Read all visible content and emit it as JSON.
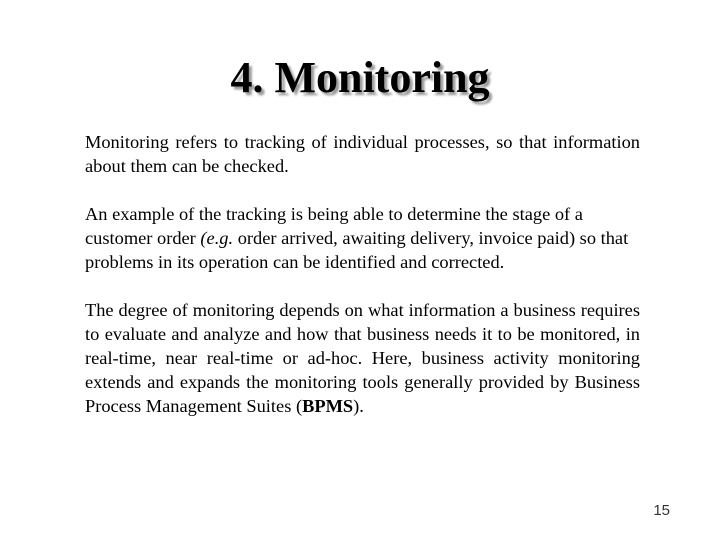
{
  "slide": {
    "title": "4.  Monitoring",
    "paragraphs": {
      "p1": "Monitoring refers to tracking of individual processes, so that information about them can be checked.",
      "p2_before": "An example of the tracking is being able to determine the stage of a customer order ",
      "p2_italic": "(e.g.",
      "p2_after": " order arrived, awaiting delivery, invoice paid) so that problems in its operation can be identified and corrected.",
      "p3_before": "The degree of monitoring depends on what information a business requires to evaluate and analyze and how that business needs it to be monitored, in real-time, near real-time or ad-hoc. Here, business activity monitoring extends and expands the monitoring tools generally provided by Business Process Management Suites (",
      "p3_bold": "BPMS",
      "p3_after": ")."
    },
    "page_number": "15"
  }
}
